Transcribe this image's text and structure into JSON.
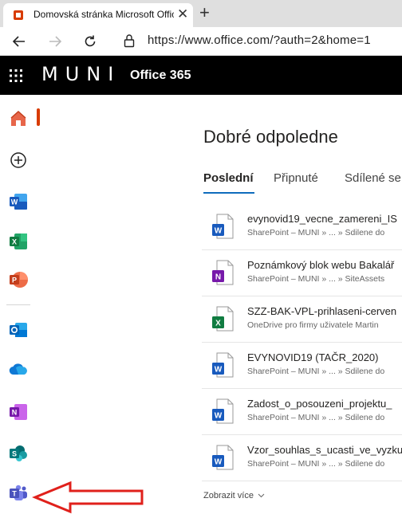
{
  "browser": {
    "tab_title": "Domovská stránka Microsoft Office",
    "close_glyph": "✕",
    "new_tab_glyph": "+",
    "url": "https://www.office.com/?auth=2&home=1"
  },
  "header": {
    "logo": "MUNI",
    "app_title": "Office 365"
  },
  "rail": {
    "items": [
      {
        "name": "home-icon",
        "color": "#d83b01"
      },
      {
        "name": "create-icon"
      },
      {
        "name": "word-icon",
        "color": "#185abd"
      },
      {
        "name": "excel-icon",
        "color": "#107c41"
      },
      {
        "name": "powerpoint-icon",
        "color": "#c43e1c"
      },
      {
        "name": "outlook-icon",
        "color": "#0364b8"
      },
      {
        "name": "onedrive-icon",
        "color": "#0f78d4"
      },
      {
        "name": "onenote-icon",
        "color": "#7719aa"
      },
      {
        "name": "sharepoint-icon",
        "color": "#03787c"
      },
      {
        "name": "teams-icon",
        "color": "#5059c9"
      }
    ]
  },
  "main": {
    "greeting": "Dobré odpoledne",
    "tabs": [
      "Poslední",
      "Připnuté",
      "Sdílené se"
    ],
    "files": [
      {
        "name": "evynovid19_vecne_zamereni_IS",
        "path": "SharePoint – MUNI » ... » Sdilene do",
        "type": "word"
      },
      {
        "name": "Poznámkový blok webu Bakalář",
        "path": "SharePoint – MUNI » ... » SiteAssets",
        "type": "onenote"
      },
      {
        "name": "SZZ-BAK-VPL-prihlaseni-cerven",
        "path": "OneDrive pro firmy uživatele Martin",
        "type": "excel"
      },
      {
        "name": "EVYNOVID19 (TAČR_2020)",
        "path": "SharePoint – MUNI » ... » Sdilene do",
        "type": "word"
      },
      {
        "name": "Zadost_o_posouzeni_projektu_",
        "path": "SharePoint – MUNI » ... » Sdilene do",
        "type": "word"
      },
      {
        "name": "Vzor_souhlas_s_ucasti_ve_vyzku",
        "path": "SharePoint – MUNI » ... » Sdilene do",
        "type": "word"
      }
    ],
    "show_more": "Zobrazit více"
  },
  "annotation": {
    "color": "#e0201b",
    "points_to": "teams-icon"
  }
}
